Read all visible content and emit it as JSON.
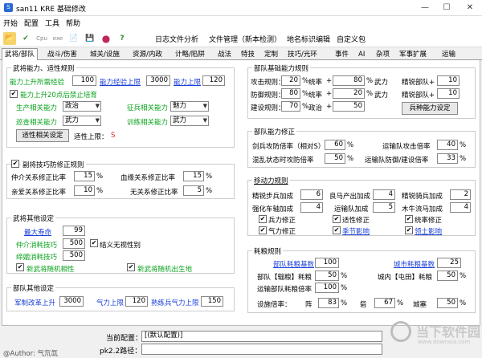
{
  "window": {
    "title": "san11 KRE 基础修改",
    "minimize": "—",
    "maximize": "☐",
    "close": "✕",
    "icon_text": "S"
  },
  "menu": [
    "开始",
    "配置",
    "工具",
    "帮助"
  ],
  "toolbar": {
    "icons": [
      "open-icon",
      "check-icon",
      "cpu-icon",
      "exe-icon",
      "file-icon",
      "save-icon",
      "color-icon",
      "help-icon"
    ],
    "icon_glyphs": [
      "📂",
      "✔",
      "Cpu",
      "exe",
      "📄",
      "💾",
      "●",
      "?"
    ],
    "buttons": [
      "日志文件分析",
      "文件管理（新本检测）",
      "地名标识编辑",
      "自定义包"
    ]
  },
  "tabs": [
    "武将/部队",
    "战斗/伤害",
    "城关/设施",
    "资源/内政",
    "计略/陷阱",
    "战法",
    "特技",
    "定制",
    "技巧/光环",
    "事件",
    "AI",
    "杂项",
    "军事扩展",
    "运输"
  ],
  "wj": {
    "title": "武将能力、适性规则",
    "row1": {
      "label1": "能力上升所需经验",
      "v1": "100",
      "label2": "能力经验上限",
      "v2": "3000",
      "label3": "能力上限",
      "v3": "120"
    },
    "chk_limit": "能力上升20点后禁止培育",
    "row2": {
      "label1": "生产相关能力",
      "sel1": "政治",
      "label2": "征兵相关能力",
      "sel2": "魅力"
    },
    "row3": {
      "label1": "巡查相关能力",
      "sel1": "武力",
      "label2": "训练相关能力",
      "sel2": "武力"
    },
    "apt_btn": "适性相关设定",
    "apt_limit_label": "适性上限：",
    "apt_limit_val": "S"
  },
  "fj": {
    "title": "副将技巧防修正规则",
    "rows": [
      {
        "label1": "仲介关系修正比率",
        "v1": "15",
        "label2": "血缘关系修正比率",
        "v2": "15"
      },
      {
        "label1": "亲爱关系修正比率",
        "v1": "10",
        "label2": "无关系修正比率",
        "v2": "5"
      }
    ],
    "pct": "%"
  },
  "other": {
    "title": "武将其他设定",
    "max_life_label": "最大寿命",
    "max_life": "99",
    "skill1_label": "仲介消耗技巧",
    "skill1": "500",
    "skill2_label": "缔姻消耗技巧",
    "skill2": "500",
    "chk_ignore": "结义无视性别",
    "chk_rand1": "新武将随机相性",
    "chk_rand2": "新武将随机出生地"
  },
  "troop": {
    "title": "部队其他设定",
    "l1": "军制改革上升",
    "v1": "3000",
    "l2": "气力上限",
    "v2": "120",
    "l3": "熟练兵气力上限",
    "v3": "150"
  },
  "base": {
    "title": "部队基础能力规则",
    "rows": [
      {
        "l1": "攻击规则：",
        "v1": "20",
        "l2": "统率",
        "v2": "80",
        "l3": "武力",
        "l4": "精锐部队+",
        "v4": "10"
      },
      {
        "l1": "防御规则：",
        "v1": "80",
        "l2": "统率",
        "v2": "20",
        "l3": "武力",
        "l4": "精锐部队+",
        "v4": "10"
      },
      {
        "l1": "建设规则：",
        "v1": "70",
        "l2": "政治",
        "v2": "50",
        "l3": "",
        "l4": "",
        "v4": ""
      }
    ],
    "btn": "兵种能力设定",
    "pct": "%",
    "plus": "+"
  },
  "mod": {
    "title": "部队能力修正",
    "rows": [
      {
        "l1": "剑兵攻防倍率（相对S）",
        "v1": "60",
        "l2": "运输队攻击倍率",
        "v2": "40"
      },
      {
        "l1": "混乱状态时攻防倍率",
        "v1": "50",
        "l2": "运输队防御/建设倍率",
        "v2": "33"
      }
    ]
  },
  "move": {
    "title": "移动力规则",
    "rows": [
      {
        "l1": "精锐步兵加成",
        "v1": "6",
        "l2": "良马产出加成",
        "v2": "4",
        "l3": "精锐骑兵加成",
        "v3": "2"
      },
      {
        "l1": "强化车轴加成",
        "v1": "4",
        "l2": "运输队加成",
        "v2": "5",
        "l3": "木牛流马加成",
        "v3": "4"
      }
    ],
    "chks": [
      {
        "label": "兵力修正",
        "checked": true
      },
      {
        "label": "适性修正",
        "checked": true
      },
      {
        "label": "统率修正",
        "checked": true
      },
      {
        "label": "气力修正",
        "checked": true
      },
      {
        "label": "季节影响",
        "checked": true
      },
      {
        "label": "领土影响",
        "checked": true
      }
    ]
  },
  "food": {
    "title": "耗粮规则",
    "r1": {
      "l1": "部队耗粮基数",
      "v1": "100",
      "l2": "城市耗粮基数",
      "v2": "25"
    },
    "r2": {
      "l1": "部队【辎粮】耗粮",
      "v1": "50",
      "l2": "城内【屯田】耗粮",
      "v2": "50"
    },
    "r3": {
      "l1": "运输部队耗粮倍率",
      "v1": "100"
    },
    "r4": {
      "l0": "设施倍率：",
      "l1": "阵",
      "v1": "83",
      "l2": "砦",
      "v2": "67",
      "l3": "城塞",
      "v3": "50"
    }
  },
  "footer": {
    "cur_cfg_label": "当前配置：",
    "cur_cfg": "[(默认配置)]",
    "path_label": "pk2.2路径：",
    "path": "",
    "author": "@Author: 气氘氙",
    "watermark": "当下软件园",
    "watermark_sub": "www.downxia.com"
  },
  "colors": {
    "accent_blue": "#1a3fd8",
    "accent_green": "#0aa31d",
    "warn_red": "#e02020"
  }
}
